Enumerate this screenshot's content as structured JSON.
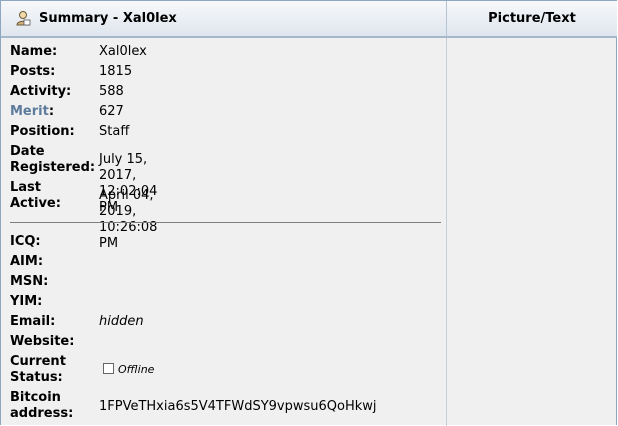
{
  "header": {
    "summary_title": "Summary - Xal0lex",
    "picture_title": "Picture/Text"
  },
  "profile": {
    "name_label": "Name:",
    "name_value": "Xal0lex",
    "posts_label": "Posts:",
    "posts_value": "1815",
    "activity_label": "Activity:",
    "activity_value": "588",
    "merit_label": "Merit",
    "merit_colon": ":",
    "merit_value": "627",
    "position_label": "Position:",
    "position_value": "Staff",
    "date_reg_label_1": "Date",
    "date_reg_label_2": "Registered:",
    "date_reg_value": "July 15, 2017, 12:02:04 PM",
    "last_active_label_1": "Last",
    "last_active_label_2": "Active:",
    "last_active_value": "April 04, 2019, 10:26:08 PM"
  },
  "contact": {
    "icq_label": "ICQ:",
    "aim_label": "AIM:",
    "msn_label": "MSN:",
    "yim_label": "YIM:",
    "email_label": "Email:",
    "email_value": "hidden",
    "website_label": "Website:",
    "status_label_1": "Current",
    "status_label_2": "Status:",
    "status_value": "Offline",
    "btc_label_1": "Bitcoin",
    "btc_label_2": "address:",
    "btc_value": "1FPVeTHxia6s5V4TFWdSY9vpwsu6QoHkwj"
  },
  "icons": {
    "summary": "user-icon",
    "status": "offline-status-icon"
  },
  "colors": {
    "merit": "#5d7b9c",
    "header_border": "#a7b8cc"
  }
}
